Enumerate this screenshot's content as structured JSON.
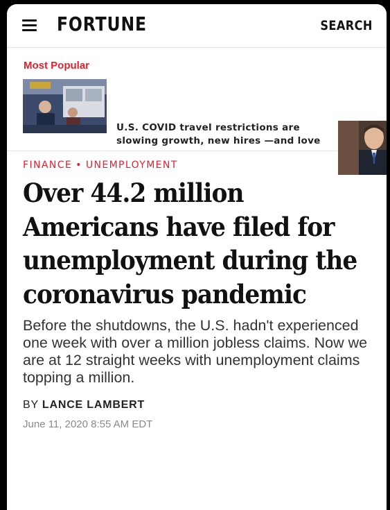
{
  "header": {
    "logo": "FORTUNE",
    "search_label": "SEARCH"
  },
  "most_popular": {
    "label": "Most Popular",
    "story": {
      "headline": "U.S. COVID travel restrictions are slowing growth, new hires —and love"
    }
  },
  "article": {
    "sections": [
      "FINANCE",
      "UNEMPLOYMENT"
    ],
    "separator": "•",
    "headline": "Over 44.2 million Americans have filed for unemployment during the coronavirus pandemic",
    "dek": "Before the shutdowns, the U.S. hadn't experienced one week with over a million jobless claims. Now we are at 12 straight weeks with unemployment claims topping a million.",
    "byline_prefix": "BY",
    "author": "LANCE LAMBERT",
    "date": "June 11, 2020 8:55 AM EDT"
  },
  "colors": {
    "accent": "#e4202c",
    "text": "#111111",
    "muted": "#8a8a8a"
  },
  "icons": [
    "hamburger-menu-icon"
  ]
}
